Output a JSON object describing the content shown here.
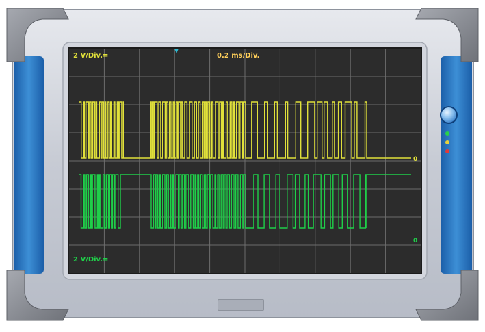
{
  "oscilloscope": {
    "colors": {
      "screen_background": "#2c2c2c",
      "grid": "#6d6d6d",
      "channel1": "#e0e03a",
      "channel2": "#1fcf49",
      "label_timebase": "#ffcf5a",
      "bezel": "#c9cdd6",
      "side_panels": "#2f7bc2",
      "corner_bumpers": "#8a8d94"
    },
    "labels": {
      "ch1_scale": "2 V/Div.=",
      "timebase": "0.2 ms/Div.",
      "ch2_scale": "2 V/Div.="
    },
    "markers": {
      "ch1_ground": "0",
      "ch2_ground": "0"
    },
    "icons": {
      "power_button": "power-icon",
      "trigger_marker": "trigger-arrow-icon"
    },
    "status_leds": [
      "green",
      "yellow",
      "red"
    ]
  }
}
